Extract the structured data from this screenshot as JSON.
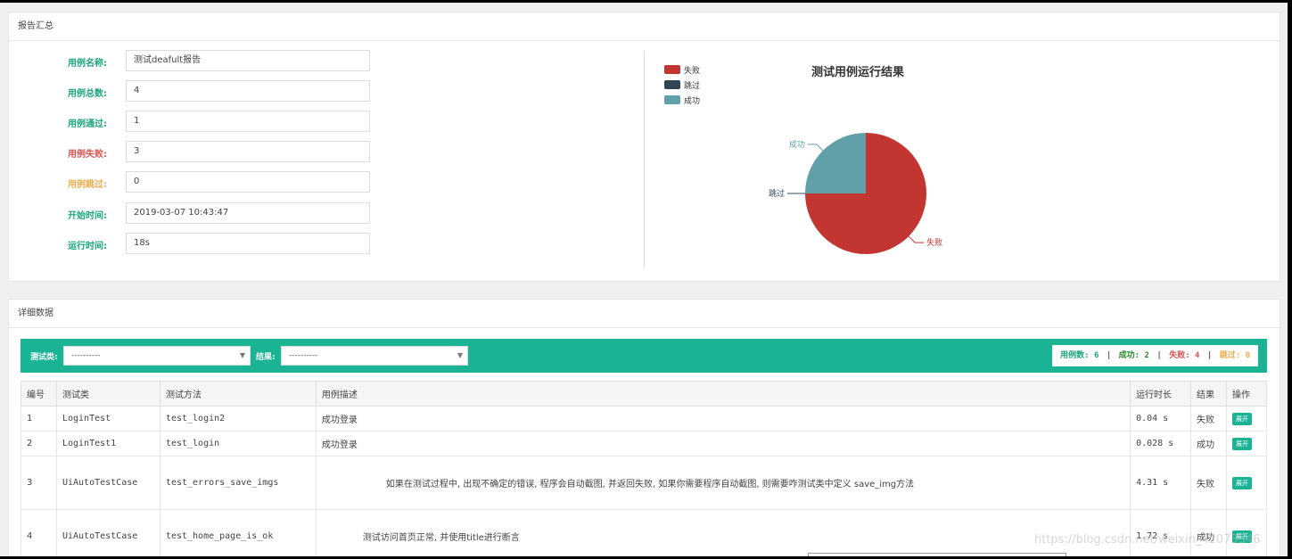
{
  "summary": {
    "title": "报告汇总",
    "rows": [
      {
        "label": "用例名称:",
        "value": "测试deafult报告",
        "tone": "green"
      },
      {
        "label": "用例总数:",
        "value": "4",
        "tone": "green"
      },
      {
        "label": "用例通过:",
        "value": "1",
        "tone": "green"
      },
      {
        "label": "用例失败:",
        "value": "3",
        "tone": "red"
      },
      {
        "label": "用例跳过:",
        "value": "0",
        "tone": "orange"
      },
      {
        "label": "开始时间:",
        "value": "2019-03-07 10:43:47",
        "tone": "green"
      },
      {
        "label": "运行时间:",
        "value": "18s",
        "tone": "green"
      }
    ]
  },
  "chart_data": {
    "type": "pie",
    "title": "测试用例运行结果",
    "legend_position": "top-left",
    "slices": [
      {
        "name": "失败",
        "value": 3,
        "color": "#c23531"
      },
      {
        "name": "跳过",
        "value": 0,
        "color": "#2f4554"
      },
      {
        "name": "成功",
        "value": 1,
        "color": "#61a0a8"
      }
    ]
  },
  "detail": {
    "title": "详细数据",
    "filter_class_label": "测试类:",
    "filter_class_value": "----------",
    "filter_result_label": "结果:",
    "filter_result_value": "----------",
    "stats": {
      "total_label": "用例数:",
      "total": "6",
      "success_label": "成功:",
      "success": "2",
      "fail_label": "失败:",
      "fail": "4",
      "skip_label": "跳过:",
      "skip": "0"
    },
    "columns": [
      "编号",
      "测试类",
      "测试方法",
      "用例描述",
      "运行时长",
      "结果",
      "操作"
    ],
    "rows": [
      {
        "id": "1",
        "cls": "LoginTest",
        "method": "test_login2",
        "desc": "成功登录",
        "time": "0.04 s",
        "result": "失败",
        "action": "展开"
      },
      {
        "id": "2",
        "cls": "LoginTest1",
        "method": "test_login",
        "desc": "成功登录",
        "time": "0.028 s",
        "result": "成功",
        "action": "展开"
      },
      {
        "id": "3",
        "cls": "UiAutoTestCase",
        "method": "test_errors_save_imgs",
        "desc": "如果在测试过程中, 出现不确定的错误, 程序会自动截图, 并返回失败, 如果你需要程序自动截图, 则需要咋测试类中定义 save_img方法",
        "time": "4.31 s",
        "result": "失败",
        "action": "展开"
      },
      {
        "id": "4",
        "cls": "UiAutoTestCase",
        "method": "test_home_page_is_ok",
        "desc": "测试访问首页正常, 并使用title进行断言",
        "time": "1.72 s",
        "result": "成功",
        "action": "展开"
      }
    ]
  },
  "watermark": "https://blog.csdn.net/weixin_42073546"
}
